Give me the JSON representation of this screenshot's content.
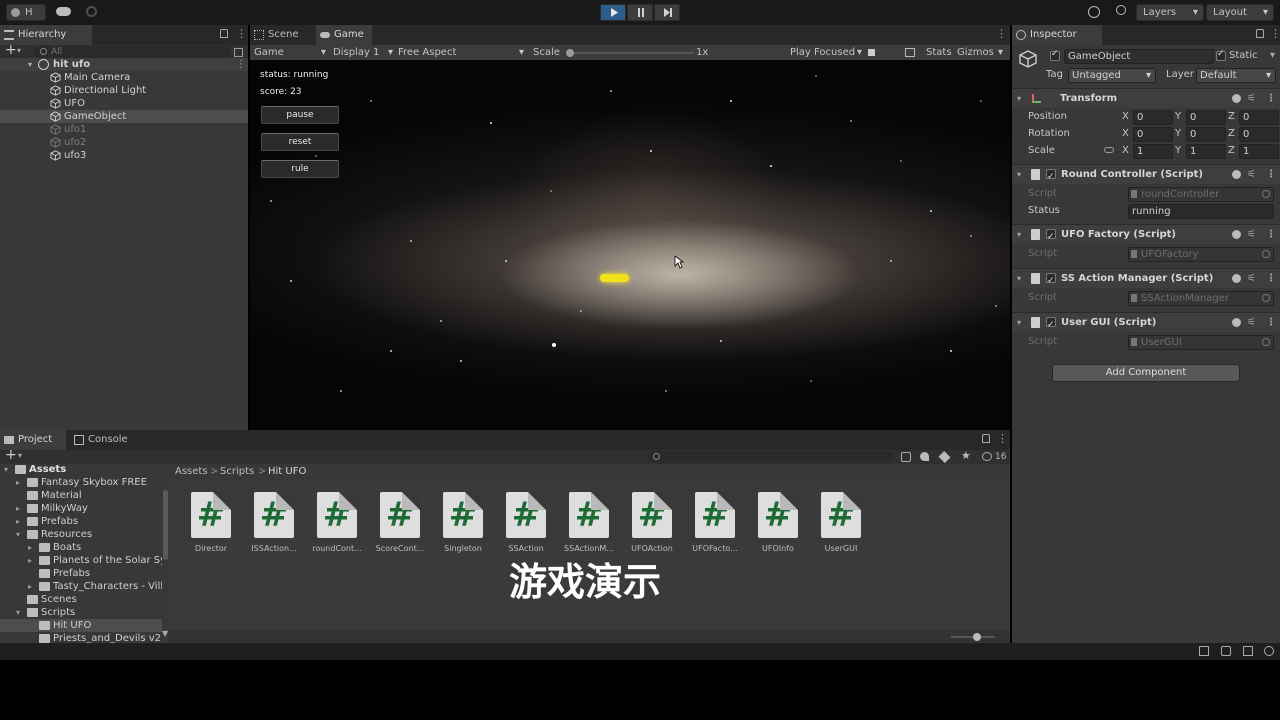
{
  "toolbar": {
    "account_label": "H",
    "layers_label": "Layers",
    "layout_label": "Layout",
    "colors": {
      "play_active": "#2f5d8a"
    }
  },
  "hierarchy": {
    "tab_label": "Hierarchy",
    "search_placeholder": "All",
    "scene_name": "hit ufo",
    "items": [
      {
        "label": "Main Camera",
        "state": "normal"
      },
      {
        "label": "Directional Light",
        "state": "normal"
      },
      {
        "label": "UFO",
        "state": "normal"
      },
      {
        "label": "GameObject",
        "state": "selected"
      },
      {
        "label": "ufo1",
        "state": "inactive"
      },
      {
        "label": "ufo2",
        "state": "inactive"
      },
      {
        "label": "ufo3",
        "state": "normal"
      }
    ]
  },
  "view_tabs": {
    "scene": "Scene",
    "game": "Game"
  },
  "game_toolbar": {
    "display_mode": "Game",
    "display": "Display 1",
    "aspect": "Free Aspect",
    "scale_label": "Scale",
    "scale_value": "1x",
    "play_focused": "Play Focused",
    "stats": "Stats",
    "gizmos": "Gizmos"
  },
  "game": {
    "status_text": "status: running",
    "score_text": "score: 23",
    "buttons": {
      "pause": "pause",
      "reset": "reset",
      "rule": "rule"
    },
    "ufo_color": "#f2e21a"
  },
  "inspector": {
    "tab_label": "Inspector",
    "object_name": "GameObject",
    "static_label": "Static",
    "tag_label": "Tag",
    "tag_value": "Untagged",
    "layer_label": "Layer",
    "layer_value": "Default",
    "transform": {
      "title": "Transform",
      "position_label": "Position",
      "rotation_label": "Rotation",
      "scale_label": "Scale",
      "axis_x": "X",
      "axis_y": "Y",
      "axis_z": "Z",
      "position": [
        "0",
        "0",
        "0"
      ],
      "rotation": [
        "0",
        "0",
        "0"
      ],
      "scale": [
        "1",
        "1",
        "1"
      ]
    },
    "components": [
      {
        "title": "Round Controller (Script)",
        "script": "roundController",
        "extra_label": "Status",
        "extra_value": "running"
      },
      {
        "title": "UFO Factory (Script)",
        "script": "UFOFactory"
      },
      {
        "title": "SS Action Manager (Script)",
        "script": "SSActionManager"
      },
      {
        "title": "User GUI (Script)",
        "script": "UserGUI"
      }
    ],
    "script_label": "Script",
    "add_component": "Add Component"
  },
  "project": {
    "tab_project": "Project",
    "tab_console": "Console",
    "breadcrumb": [
      "Assets",
      "Scripts",
      "Hit UFO"
    ],
    "hidden_count": "16",
    "tree": [
      {
        "label": "Assets",
        "depth": 0,
        "expanded": true,
        "bold": true
      },
      {
        "label": "Fantasy Skybox FREE",
        "depth": 1,
        "expanded": false
      },
      {
        "label": "Material",
        "depth": 1,
        "expanded": null
      },
      {
        "label": "MilkyWay",
        "depth": 1,
        "expanded": false
      },
      {
        "label": "Prefabs",
        "depth": 1,
        "expanded": false
      },
      {
        "label": "Resources",
        "depth": 1,
        "expanded": true
      },
      {
        "label": "Boats",
        "depth": 2,
        "expanded": false
      },
      {
        "label": "Planets of the Solar Sy",
        "depth": 2,
        "expanded": false
      },
      {
        "label": "Prefabs",
        "depth": 2,
        "expanded": null
      },
      {
        "label": "Tasty_Characters - Villi",
        "depth": 2,
        "expanded": false
      },
      {
        "label": "Scenes",
        "depth": 1,
        "expanded": null
      },
      {
        "label": "Scripts",
        "depth": 1,
        "expanded": true
      },
      {
        "label": "Hit UFO",
        "depth": 2,
        "expanded": null,
        "selected": true
      },
      {
        "label": "Priests_and_Devils v2",
        "depth": 2,
        "expanded": null
      }
    ],
    "assets": [
      "Director",
      "ISSAction...",
      "roundCont...",
      "ScoreCont...",
      "Singleton",
      "SSAction",
      "SSActionM...",
      "UFOAction",
      "UFOFacto...",
      "UFOInfo",
      "UserGUI"
    ],
    "asset_glyph": "#"
  },
  "caption": "游戏演示"
}
